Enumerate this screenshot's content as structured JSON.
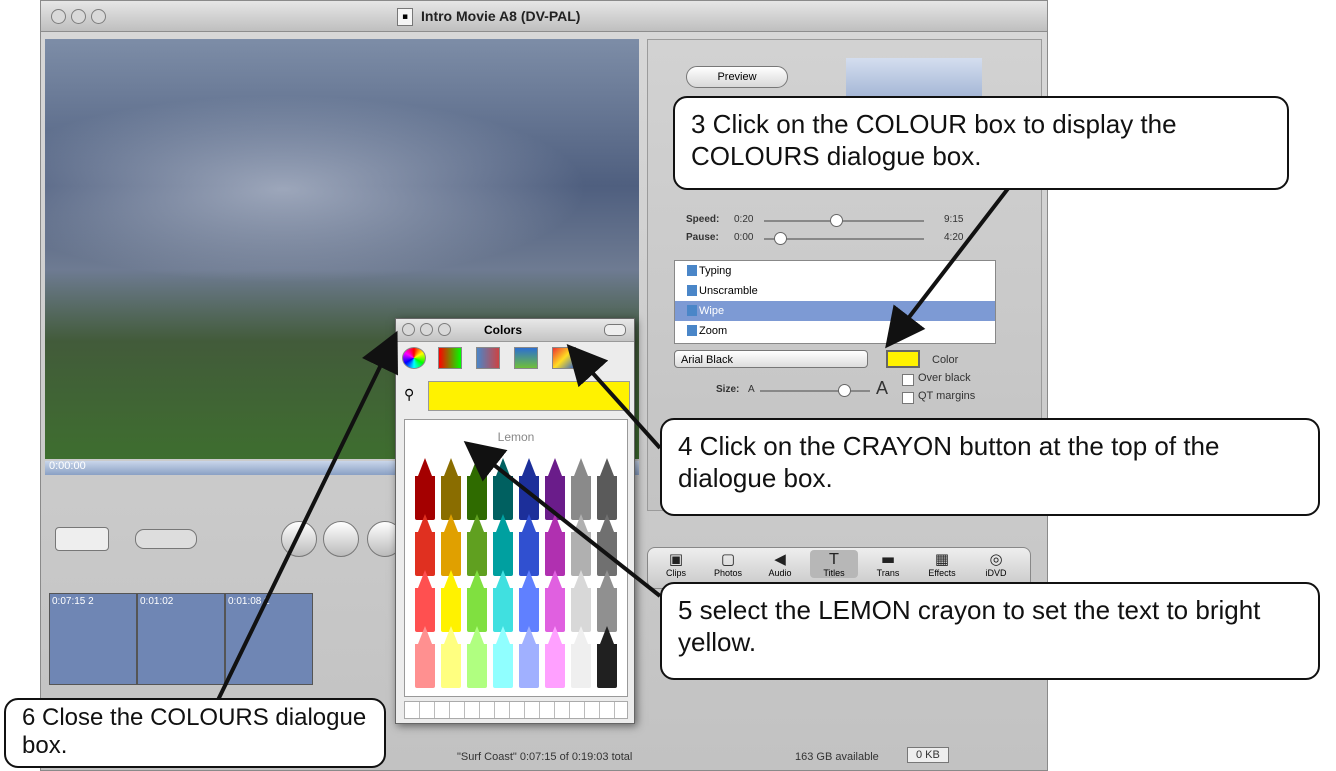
{
  "window": {
    "title": "Intro Movie A8 (DV-PAL)"
  },
  "viewer": {
    "timecode": "0:00:00"
  },
  "clips": [
    {
      "label": "0:07:15 2"
    },
    {
      "label": "0:01:02"
    },
    {
      "label": "0:01:08 2"
    }
  ],
  "status": {
    "clip_info": "\"Surf Coast\"  0:07:15 of 0:19:03 total",
    "available": "163 GB available",
    "trash": "0 KB"
  },
  "titles_panel": {
    "preview_button": "Preview",
    "speed_label": "Speed:",
    "speed_min": "0:20",
    "speed_max": "9:15",
    "pause_label": "Pause:",
    "pause_min": "0:00",
    "pause_max": "4:20",
    "list": [
      {
        "label": "Typing",
        "selected": false
      },
      {
        "label": "Unscramble",
        "selected": false
      },
      {
        "label": "Wipe",
        "selected": true
      },
      {
        "label": "Zoom",
        "selected": false
      }
    ],
    "font_dropdown": "Arial Black",
    "color_label": "Color",
    "color_value": "#fff200",
    "size_label": "Size:",
    "size_small": "A",
    "size_large": "A",
    "over_black": "Over black",
    "qt_margins": "QT margins"
  },
  "toolbar": {
    "buttons": [
      {
        "label": "Clips",
        "glyph": "▣"
      },
      {
        "label": "Photos",
        "glyph": "▢"
      },
      {
        "label": "Audio",
        "glyph": "◀"
      },
      {
        "label": "Titles",
        "glyph": "T",
        "active": true
      },
      {
        "label": "Trans",
        "glyph": "▬"
      },
      {
        "label": "Effects",
        "glyph": "▦"
      },
      {
        "label": "iDVD",
        "glyph": "◎"
      }
    ]
  },
  "colors_dialog": {
    "title": "Colors",
    "selected_crayon": "Lemon",
    "field_color": "#fff200",
    "tabs": [
      "color-wheel",
      "color-sliders",
      "color-palettes",
      "image-palettes",
      "crayons"
    ]
  },
  "callouts": {
    "c3": "3  Click on the COLOUR box to display the COLOURS dialogue box.",
    "c4": "4  Click on the CRAYON button at the top of the dialogue box.",
    "c5": "5  select the LEMON crayon to set the text to bright yellow.",
    "c6": "6  Close the COLOURS dialogue box."
  }
}
